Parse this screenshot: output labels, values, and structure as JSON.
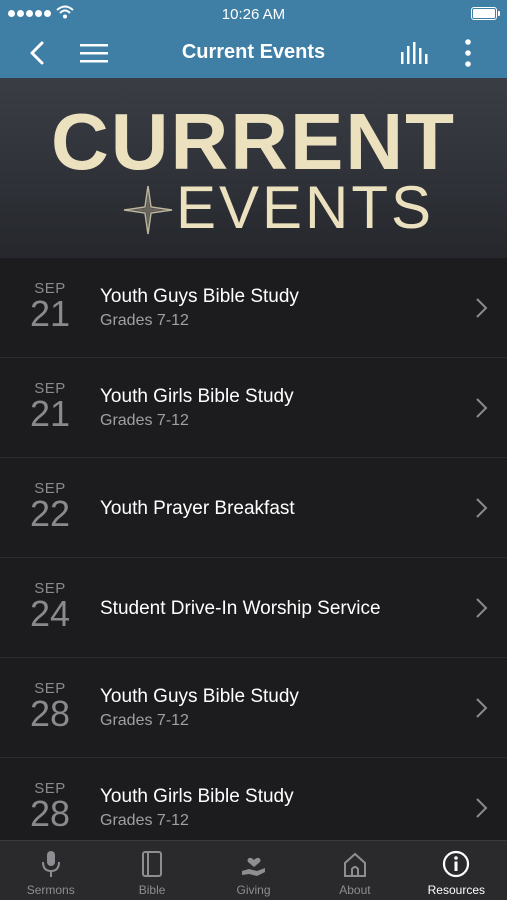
{
  "status_bar": {
    "time": "10:26 AM"
  },
  "nav": {
    "title": "Current Events"
  },
  "banner": {
    "line1": "CURRENT",
    "line2": "EVENTS"
  },
  "events": [
    {
      "month": "SEP",
      "day": "21",
      "title": "Youth Guys Bible Study",
      "subtitle": "Grades 7-12"
    },
    {
      "month": "SEP",
      "day": "21",
      "title": "Youth Girls Bible Study",
      "subtitle": "Grades 7-12"
    },
    {
      "month": "SEP",
      "day": "22",
      "title": "Youth Prayer Breakfast",
      "subtitle": ""
    },
    {
      "month": "SEP",
      "day": "24",
      "title": "Student Drive-In Worship Service",
      "subtitle": ""
    },
    {
      "month": "SEP",
      "day": "28",
      "title": "Youth Guys Bible Study",
      "subtitle": "Grades 7-12"
    },
    {
      "month": "SEP",
      "day": "28",
      "title": "Youth Girls Bible Study",
      "subtitle": "Grades 7-12"
    }
  ],
  "tabs": [
    {
      "label": "Sermons",
      "icon": "microphone-icon"
    },
    {
      "label": "Bible",
      "icon": "book-icon"
    },
    {
      "label": "Giving",
      "icon": "giving-hand-icon"
    },
    {
      "label": "About",
      "icon": "church-icon"
    },
    {
      "label": "Resources",
      "icon": "info-icon",
      "active": true
    }
  ],
  "colors": {
    "header": "#3f7ea5",
    "background": "#1c1c1e",
    "banner_text": "#ece1bf",
    "tabbar": "#2a2a2c"
  }
}
